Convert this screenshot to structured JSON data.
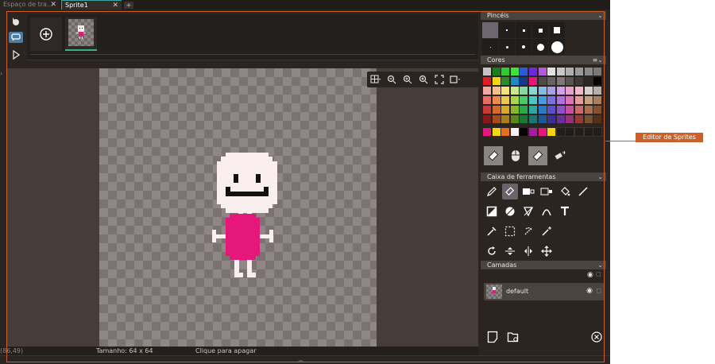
{
  "tabs": [
    {
      "label": "Espaço de tra...",
      "active": false
    },
    {
      "label": "Sprite1",
      "active": true
    }
  ],
  "add_tab_label": "+",
  "panels": {
    "brushes_title": "Pincéis",
    "colors_title": "Cores",
    "toolbox_title": "Caixa de ferramentas",
    "layers_title": "Camadas"
  },
  "layers": [
    {
      "name": "default"
    }
  ],
  "status": {
    "coords": "(86,49)",
    "size": "Tamanho: 64 x 64",
    "hint": "Clique para apagar"
  },
  "callout": "Editor de Sprites",
  "colors": {
    "accent_orange": "#c8622a",
    "selection": "#4a7ea8",
    "sprite_pink": "#e6177a",
    "sprite_face": "#fbeeee"
  },
  "palette": [
    [
      "#c8c3c3",
      "#1a7f1a",
      "#2ecc2e",
      "#39e639",
      "#2a5bd8",
      "#6a2ae0",
      "#b35ad8",
      "#e2e2e2",
      "#c8c8c8",
      "#b0b0b0",
      "#9a9a9a",
      "#8a8a8a",
      "#7a7a7a"
    ],
    [
      "#e01b24",
      "#f5d60a",
      "#2c8a2c",
      "#1e88c8",
      "#123a8a",
      "#e6177a",
      "#4f4a48",
      "#686360",
      "#7f7a77",
      "#5a5553",
      "#3e3a38",
      "#2b2826",
      "#050505"
    ],
    [
      "#f2a6a6",
      "#f7c08a",
      "#f5e07a",
      "#c9e88a",
      "#8ad8a0",
      "#8ad8d0",
      "#8ab8e8",
      "#a8a0e8",
      "#d0a0e8",
      "#e8a0d0",
      "#f0b8c8",
      "#d8d0c8",
      "#b8b0a8"
    ],
    [
      "#e86a6a",
      "#f08a4a",
      "#f0c84a",
      "#a8d84a",
      "#4ac86a",
      "#4ac8c0",
      "#4a98e0",
      "#7a70e0",
      "#b070e0",
      "#e070b8",
      "#e89a9a",
      "#c8a080",
      "#a88060"
    ],
    [
      "#c83a3a",
      "#d8682a",
      "#d8a82a",
      "#88b82a",
      "#2aa84a",
      "#2aa8a0",
      "#2a78c8",
      "#5a50c8",
      "#9050c8",
      "#c850a0",
      "#c86a6a",
      "#a87050",
      "#885030"
    ],
    [
      "#8a1a1a",
      "#a84a1a",
      "#a8801a",
      "#5a881a",
      "#1a7832",
      "#1a7870",
      "#1a5898",
      "#3a3098",
      "#683098",
      "#983078",
      "#983a3a",
      "#785030",
      "#583018"
    ]
  ],
  "custom_colors": [
    "#e6177a",
    "#f5d60a",
    "#e8701a",
    "#fbeeee",
    "#050505",
    "#a020a0",
    "#e6177a",
    "#f5d60a",
    "",
    "",
    "",
    "",
    ""
  ]
}
